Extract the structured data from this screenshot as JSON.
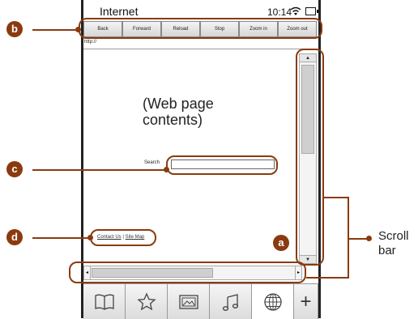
{
  "status": {
    "app_title": "Internet",
    "time": "10:14"
  },
  "toolbar": {
    "buttons": [
      "Back",
      "Forward",
      "Reload",
      "Stop",
      "Zoom in",
      "Zoom out"
    ]
  },
  "address": {
    "value": "http://"
  },
  "content": {
    "placeholder_line1": "(Web page",
    "placeholder_line2": "contents)",
    "search_label": "Search",
    "footer_link1": "Contact Us",
    "footer_separator": "|",
    "footer_link2": "Site Map"
  },
  "tabs": [
    "book-icon",
    "star-icon",
    "picture-icon",
    "music-icon",
    "globe-icon",
    "plus"
  ],
  "tab_plus_label": "+",
  "callouts": {
    "a": "a",
    "b": "b",
    "c": "c",
    "d": "d",
    "scroll_label_line1": "Scroll",
    "scroll_label_line2": "bar"
  },
  "accent_color": "#8b3a0f"
}
